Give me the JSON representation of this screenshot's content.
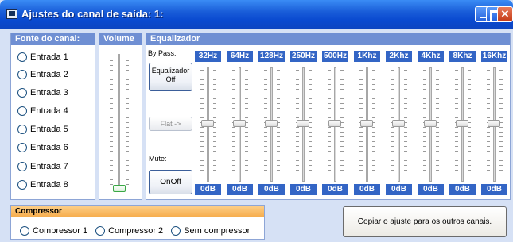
{
  "window": {
    "title": "Ajustes do canal de saída: 1:"
  },
  "source_panel": {
    "heading": "Fonte do canal:",
    "inputs": [
      "Entrada 1",
      "Entrada 2",
      "Entrada 3",
      "Entrada 4",
      "Entrada 5",
      "Entrada 6",
      "Entrada 7",
      "Entrada 8"
    ]
  },
  "volume_panel": {
    "heading": "Volume",
    "level": 0.0
  },
  "equalizer": {
    "heading": "Equalizador",
    "bypass_label": "By Pass:",
    "equalizer_button": [
      "Equalizador",
      "Off"
    ],
    "flat_button": "Flat ->",
    "mute_label": "Mute:",
    "onoff_button": "OnOff",
    "bands": [
      {
        "freq": "32Hz",
        "gain": "0dB"
      },
      {
        "freq": "64Hz",
        "gain": "0dB"
      },
      {
        "freq": "128Hz",
        "gain": "0dB"
      },
      {
        "freq": "250Hz",
        "gain": "0dB"
      },
      {
        "freq": "500Hz",
        "gain": "0dB"
      },
      {
        "freq": "1Khz",
        "gain": "0dB"
      },
      {
        "freq": "2Khz",
        "gain": "0dB"
      },
      {
        "freq": "4Khz",
        "gain": "0dB"
      },
      {
        "freq": "8Khz",
        "gain": "0dB"
      },
      {
        "freq": "16Khz",
        "gain": "0dB"
      }
    ]
  },
  "compressor": {
    "heading": "Compressor",
    "options": [
      "Compressor 1",
      "Compressor 2",
      "Sem compressor"
    ]
  },
  "copy_button": "Copiar o ajuste para os outros canais."
}
